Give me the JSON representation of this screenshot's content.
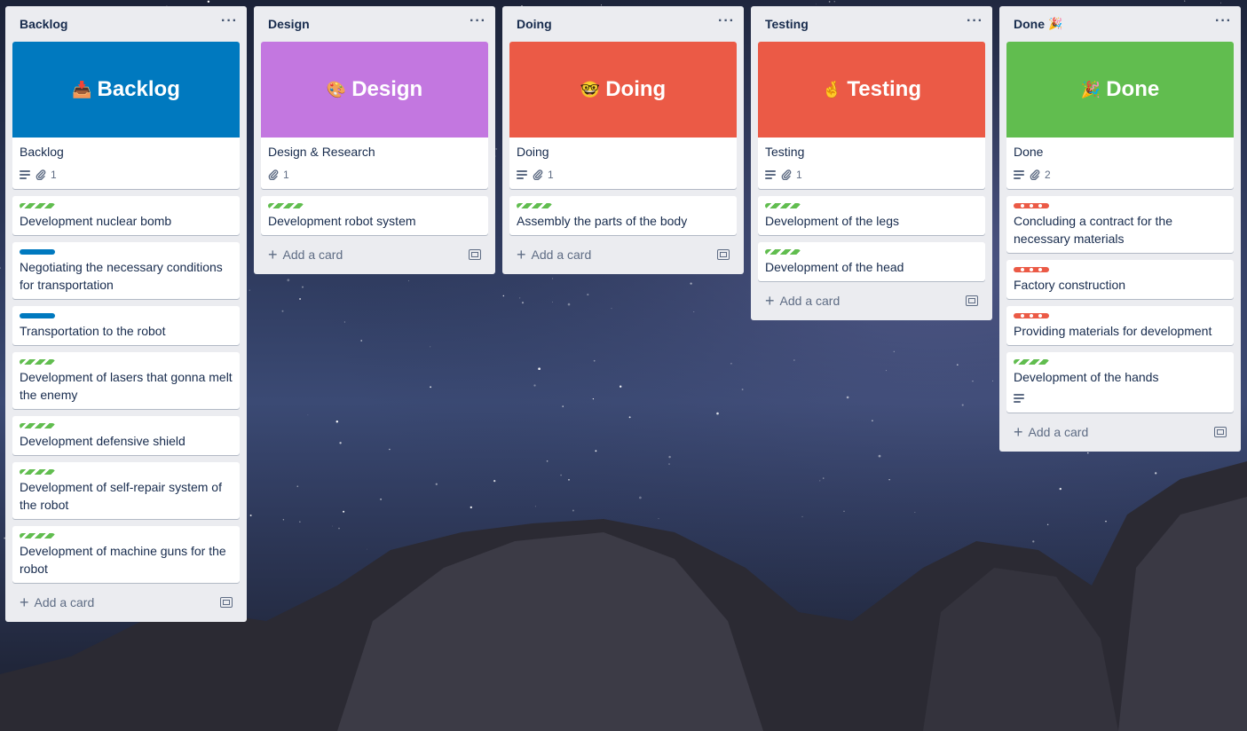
{
  "colors": {
    "blue": "#0079bf",
    "purple": "#c377e0",
    "red": "#eb5a46",
    "green": "#61bd4f"
  },
  "add_card_label": "Add a card",
  "lists": [
    {
      "title": "Backlog",
      "title_emoji": "",
      "cover": {
        "color": "#0079bf",
        "emoji": "📥",
        "text": "Backlog"
      },
      "cover_card": {
        "title": "Backlog",
        "has_description": true,
        "attachments": "1"
      },
      "cards": [
        {
          "label": "green",
          "title": "Development nuclear bomb"
        },
        {
          "label": "blue",
          "title": "Negotiating the necessary conditions for transportation"
        },
        {
          "label": "blue",
          "title": "Transportation to the robot"
        },
        {
          "label": "green",
          "title": "Development of lasers that gonna melt the enemy"
        },
        {
          "label": "green",
          "title": "Development defensive shield"
        },
        {
          "label": "green",
          "title": "Development of self-repair system of the robot"
        },
        {
          "label": "green",
          "title": "Development of machine guns for the robot"
        }
      ]
    },
    {
      "title": "Design",
      "title_emoji": "",
      "cover": {
        "color": "#c377e0",
        "emoji": "🎨",
        "text": "Design"
      },
      "cover_card": {
        "title": "Design & Research",
        "has_description": false,
        "attachments": "1"
      },
      "cards": [
        {
          "label": "green",
          "title": "Development robot system"
        }
      ]
    },
    {
      "title": "Doing",
      "title_emoji": "",
      "cover": {
        "color": "#eb5a46",
        "emoji": "🤓",
        "text": "Doing"
      },
      "cover_card": {
        "title": "Doing",
        "has_description": true,
        "attachments": "1"
      },
      "cards": [
        {
          "label": "green",
          "title": "Assembly the parts of the body"
        }
      ]
    },
    {
      "title": "Testing",
      "title_emoji": "",
      "cover": {
        "color": "#eb5a46",
        "emoji": "🤞",
        "text": "Testing"
      },
      "cover_card": {
        "title": "Testing",
        "has_description": true,
        "attachments": "1"
      },
      "cards": [
        {
          "label": "green",
          "title": "Development of the legs"
        },
        {
          "label": "green",
          "title": "Development of the head"
        }
      ]
    },
    {
      "title": "Done",
      "title_emoji": "🎉",
      "cover": {
        "color": "#61bd4f",
        "emoji": "🎉",
        "text": "Done"
      },
      "cover_card": {
        "title": "Done",
        "has_description": true,
        "attachments": "2"
      },
      "cards": [
        {
          "label": "red",
          "title": "Concluding a contract for the necessary materials"
        },
        {
          "label": "red",
          "title": "Factory construction"
        },
        {
          "label": "red",
          "title": "Providing materials for development"
        },
        {
          "label": "green",
          "title": "Development of the hands",
          "has_description": true
        }
      ]
    }
  ]
}
